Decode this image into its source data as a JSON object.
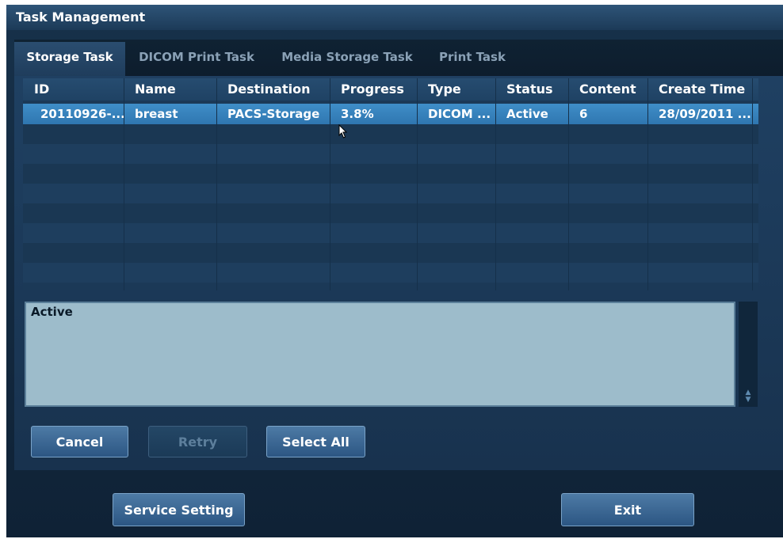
{
  "window": {
    "title": "Task Management"
  },
  "tabs": [
    {
      "label": "Storage Task",
      "active": true
    },
    {
      "label": "DICOM Print Task",
      "active": false
    },
    {
      "label": "Media Storage Task",
      "active": false
    },
    {
      "label": "Print Task",
      "active": false
    }
  ],
  "table": {
    "columns": [
      "ID",
      "Name",
      "Destination",
      "Progress",
      "Type",
      "Status",
      "Content",
      "Create Time"
    ],
    "rows": [
      {
        "id": "20110926-...",
        "name": "breast",
        "destination": "PACS-Storage",
        "progress": "3.8%",
        "type": "DICOM ...",
        "status": "Active",
        "content": "6",
        "create_time": "28/09/2011 ..."
      }
    ],
    "selected_row": 0
  },
  "detail": {
    "text": "Active"
  },
  "actions": {
    "cancel": "Cancel",
    "retry": "Retry",
    "select_all": "Select All"
  },
  "footer": {
    "service_setting": "Service Setting",
    "exit": "Exit"
  },
  "colors": {
    "selected_row": "#3a88c2",
    "detail_bg": "#9dbccb",
    "window_bg": "#17314a"
  },
  "icons": {
    "scroll": "scroll-up-down-icon",
    "cursor": "mouse-pointer-icon"
  }
}
